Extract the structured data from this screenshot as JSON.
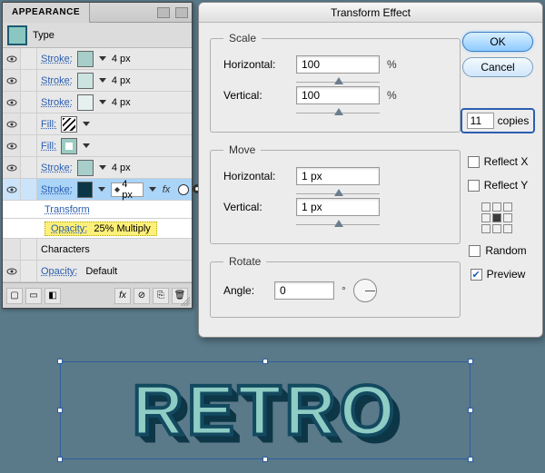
{
  "appearance": {
    "tab": "APPEARANCE",
    "type_label": "Type",
    "rows": [
      {
        "label": "Stroke:",
        "size": "4 px"
      },
      {
        "label": "Stroke:",
        "size": "4 px"
      },
      {
        "label": "Stroke:",
        "size": "4 px"
      },
      {
        "label": "Fill:"
      },
      {
        "label": "Fill:"
      },
      {
        "label": "Stroke:",
        "size": "4 px"
      },
      {
        "label": "Stroke:",
        "size": "4 px"
      }
    ],
    "transform_sub": "Transform",
    "opacity_sub_label": "Opacity:",
    "opacity_sub_value": "25% Multiply",
    "characters": "Characters",
    "default_opacity_label": "Opacity:",
    "default_opacity_value": "Default"
  },
  "dialog": {
    "title": "Transform Effect",
    "scale": {
      "legend": "Scale",
      "h_label": "Horizontal:",
      "h_value": "100",
      "v_label": "Vertical:",
      "v_value": "100",
      "unit": "%"
    },
    "move": {
      "legend": "Move",
      "h_label": "Horizontal:",
      "h_value": "1 px",
      "v_label": "Vertical:",
      "v_value": "1 px"
    },
    "rotate": {
      "legend": "Rotate",
      "angle_label": "Angle:",
      "angle_value": "0",
      "unit": "°"
    },
    "ok": "OK",
    "cancel": "Cancel",
    "copies_value": "11",
    "copies_label": "copies",
    "reflect_x": "Reflect X",
    "reflect_y": "Reflect Y",
    "random": "Random",
    "preview": "Preview"
  },
  "art": {
    "text": "RETRO"
  }
}
